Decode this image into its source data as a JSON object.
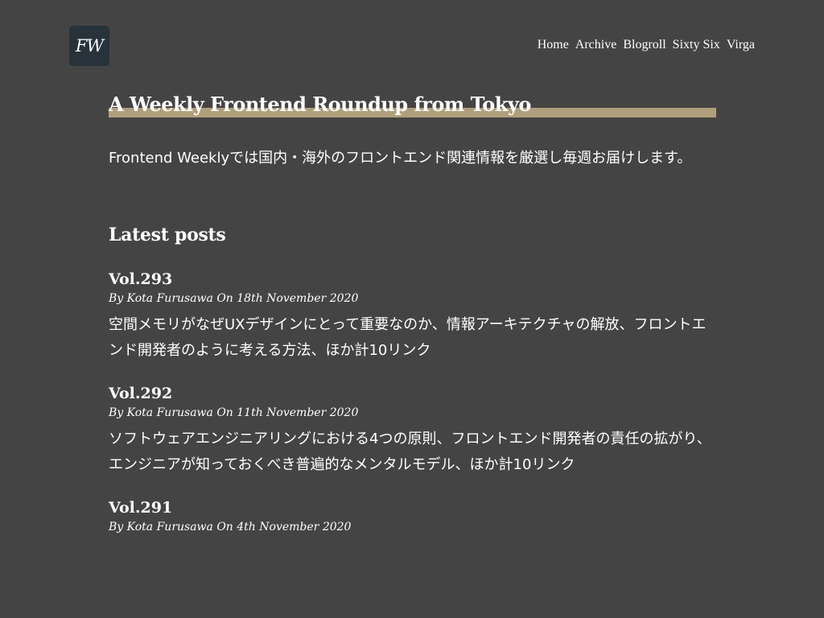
{
  "header": {
    "logo_text": "FW",
    "nav": [
      "Home",
      "Archive",
      "Blogroll",
      "Sixty Six",
      "Virga"
    ]
  },
  "main": {
    "headline": "A Weekly Frontend Roundup from Tokyo",
    "intro": "Frontend Weeklyでは国内・海外のフロントエンド関連情報を厳選し毎週お届けします。",
    "latest_title": "Latest posts",
    "posts": [
      {
        "title": "Vol.293",
        "meta": "By Kota Furusawa On 18th November 2020",
        "summary": "空間メモリがなぜUXデザインにとって重要なのか、情報アーキテクチャの解放、フロントエンド開発者のように考える方法、ほか計10リンク"
      },
      {
        "title": "Vol.292",
        "meta": "By Kota Furusawa On 11th November 2020",
        "summary": "ソフトウェアエンジニアリングにおける4つの原則、フロントエンド開発者の責任の拡がり、エンジニアが知っておくべき普遍的なメンタルモデル、ほか計10リンク"
      },
      {
        "title": "Vol.291",
        "meta": "By Kota Furusawa On 4th November 2020",
        "summary": ""
      }
    ]
  }
}
